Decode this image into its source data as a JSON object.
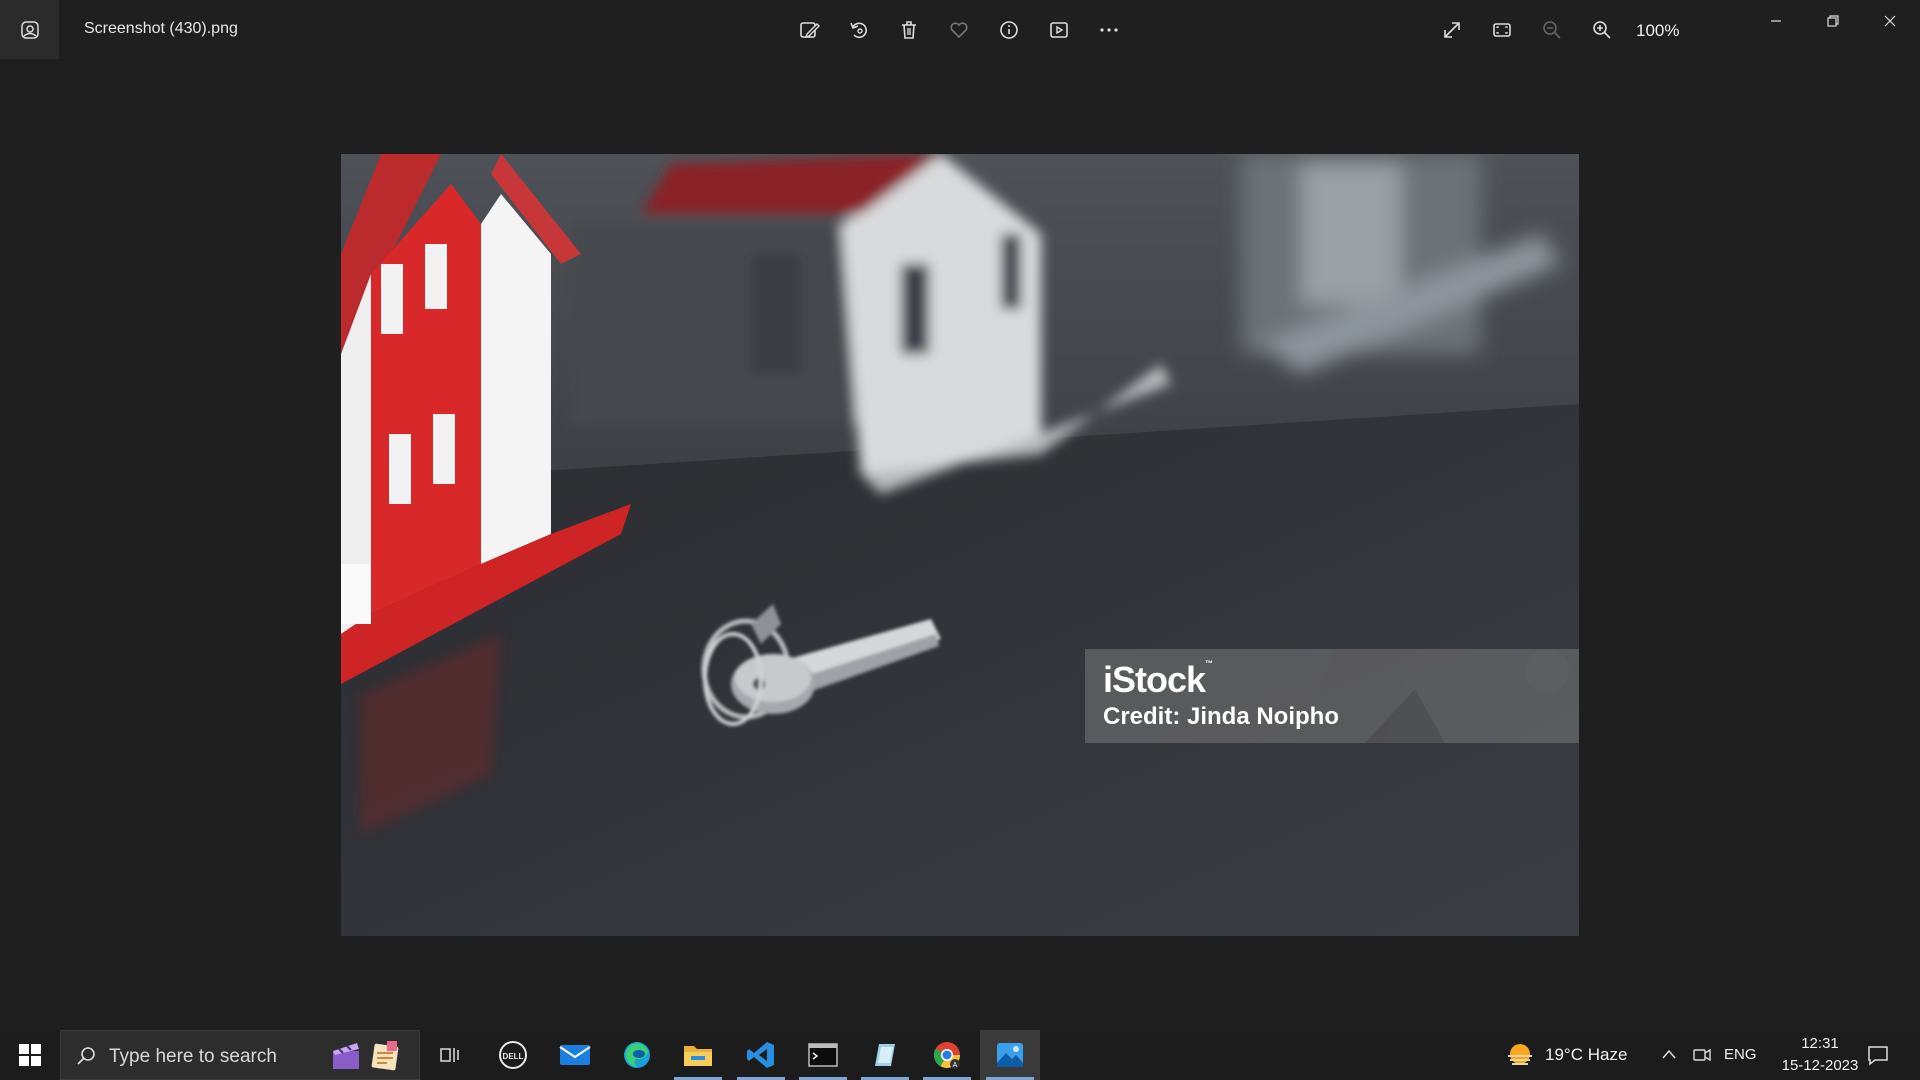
{
  "window": {
    "title": "Screenshot (430).png",
    "zoom": "100%",
    "toolbar_icons": [
      "edit-image-icon",
      "rotate-icon",
      "delete-icon",
      "favorite-heart-icon",
      "info-icon",
      "slideshow-icon",
      "more-options-icon"
    ],
    "view_icons": [
      "fullscreen-icon",
      "fit-to-window-icon",
      "zoom-out-icon",
      "zoom-in-icon"
    ]
  },
  "photo": {
    "watermark_brand": "iStock",
    "watermark_tm": "™",
    "watermark_credit": "Credit: Jinda Noipho"
  },
  "taskbar": {
    "search_placeholder": "Type here to search",
    "apps": [
      "task-view",
      "dell",
      "mail",
      "edge",
      "file-explorer",
      "vs-code",
      "terminal",
      "notes",
      "chrome",
      "photos"
    ],
    "weather": "19°C  Haze",
    "language": "ENG",
    "time": "12:31",
    "date": "15-12-2023"
  },
  "colors": {
    "app_background": "#1f1f1f",
    "taskbar_background": "#1c1c1c",
    "house_red": "#d8282a"
  }
}
